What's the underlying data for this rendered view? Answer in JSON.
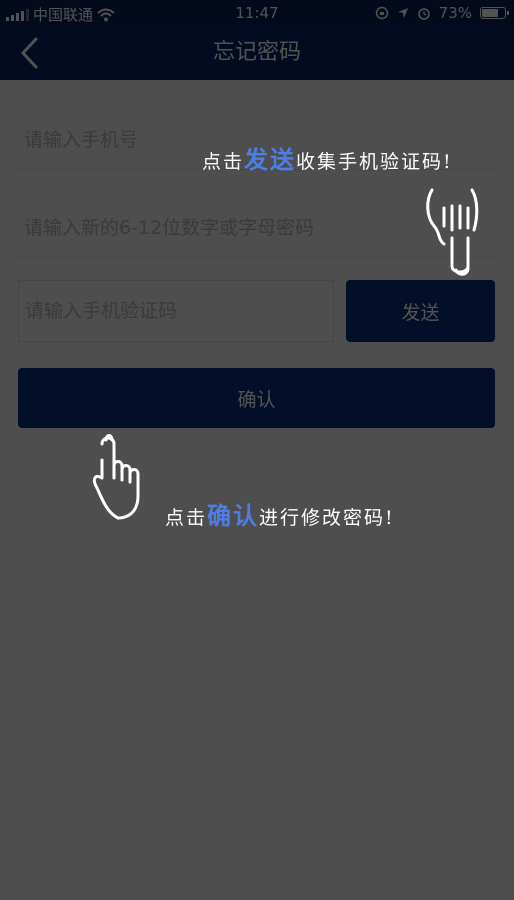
{
  "status_bar": {
    "carrier": "中国联通",
    "time": "11:47",
    "battery": "73%",
    "battery_level": 0.73
  },
  "nav": {
    "title": "忘记密码",
    "back_icon": "chevron-left-icon"
  },
  "form": {
    "phone_placeholder": "请输入手机号",
    "password_placeholder": "请输入新的6-12位数字或字母密码",
    "code_placeholder": "请输入手机验证码",
    "send_label": "发送",
    "confirm_label": "确认"
  },
  "guide": {
    "send_tip": {
      "prefix": "点击",
      "highlight": "发送",
      "suffix": "收集手机验证码!"
    },
    "confirm_tip": {
      "prefix": "点击",
      "highlight": "确认",
      "suffix": "进行修改密码!"
    },
    "highlight_color": "#4d7ee6",
    "hand_icon": "pointing-hand-icon"
  },
  "colors": {
    "nav_background": "#0b2268",
    "button_background": "#0c2d80",
    "page_background": "#f1f1f1"
  }
}
